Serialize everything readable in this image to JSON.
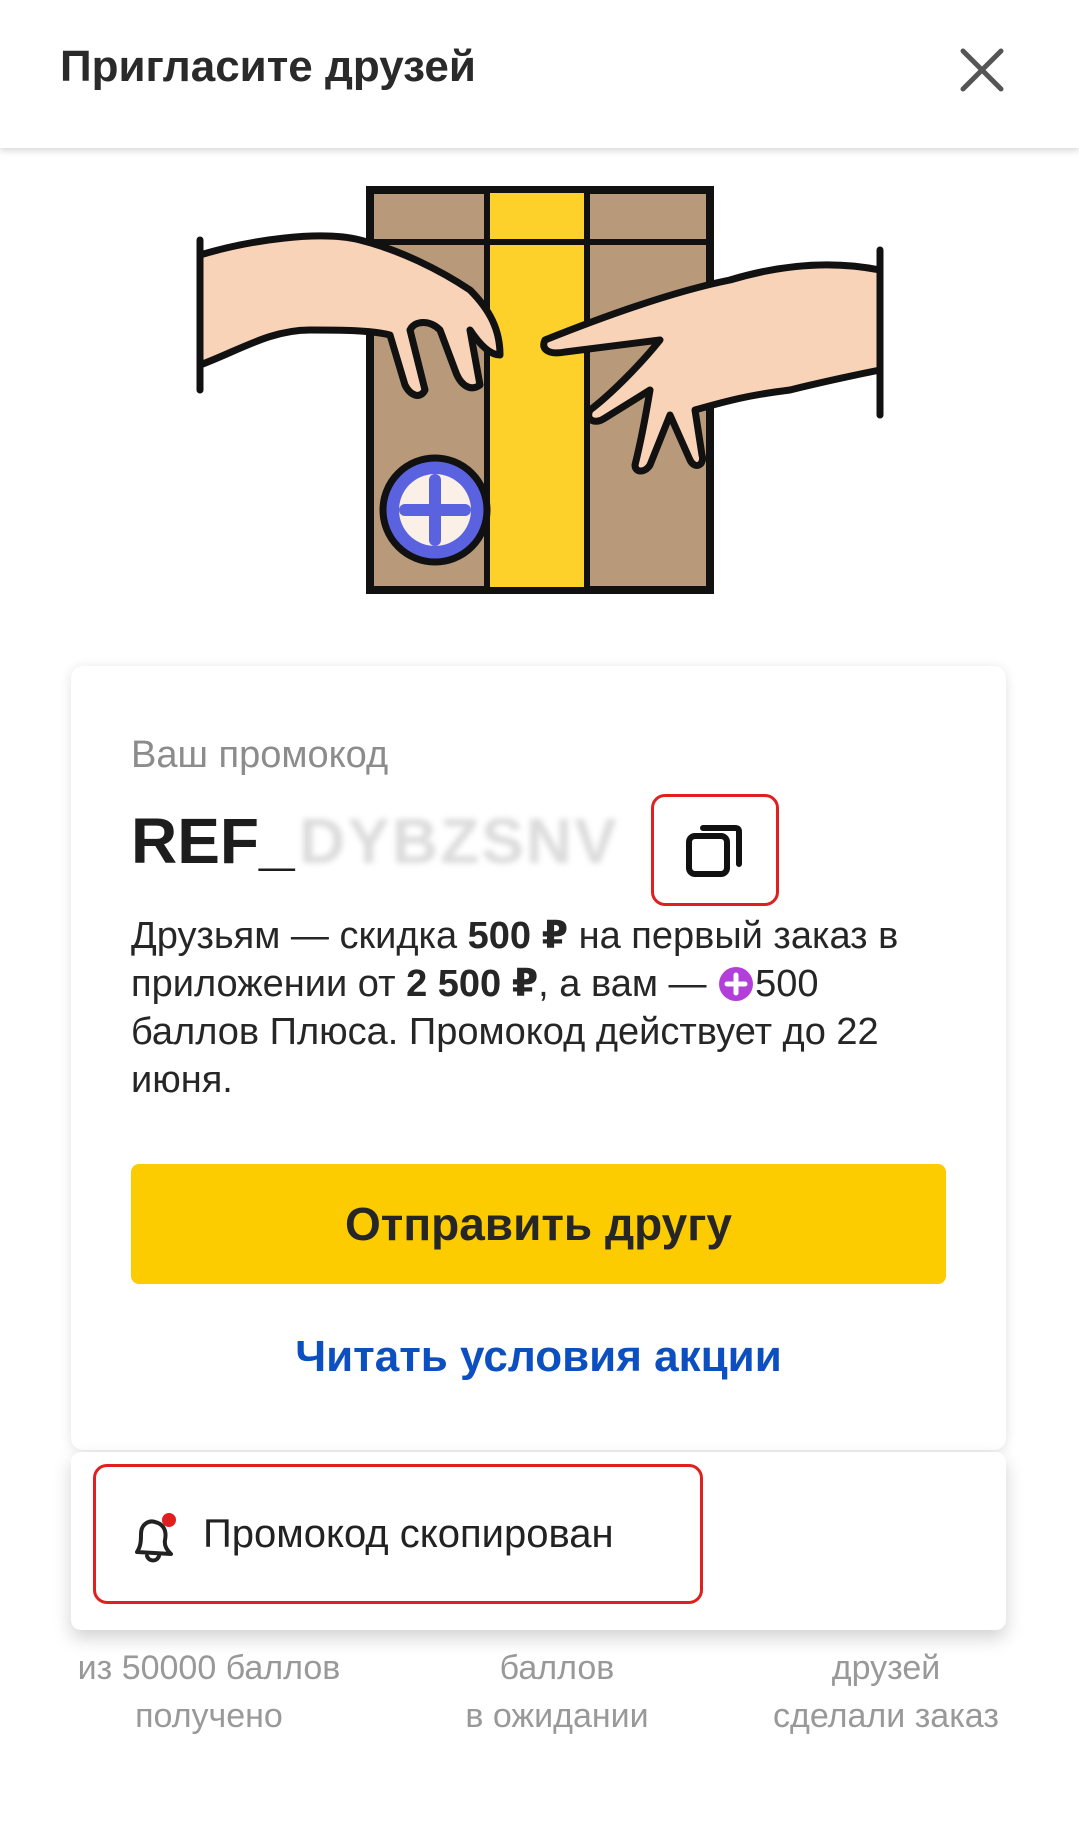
{
  "header": {
    "title": "Пригласите друзей",
    "close_icon": "close-icon"
  },
  "illustration": {
    "name": "gift-box-hands",
    "plus_badge_icon": "plus-badge-icon"
  },
  "promo": {
    "label": "Ваш промокод",
    "code_prefix": "REF_",
    "code_masked": "DYBZSNV",
    "copy_icon": "copy-icon",
    "description": {
      "part1": "Друзьям — скидка ",
      "discount": "500 ₽",
      "part2": " на первый заказ в приложении от ",
      "min_order": "2 500 ₽",
      "part3": ", а вам — ",
      "points": "500",
      "part4": " баллов Плюса. Промокод действует до 22 июня."
    },
    "send_button": "Отправить другу",
    "terms_link": "Читать условия акции"
  },
  "toast": {
    "text": "Промокод скопирован",
    "icon": "bell-icon"
  },
  "stats": [
    {
      "line1": "из 50000 баллов",
      "line2": "получено"
    },
    {
      "line1": "баллов",
      "line2": "в ожидании"
    },
    {
      "line1": "друзей",
      "line2": "сделали заказ"
    }
  ],
  "colors": {
    "accent_yellow": "#fccc00",
    "link_blue": "#0b4fc0",
    "plus_purple": "#b23fd9",
    "highlight_red": "#e02020"
  }
}
